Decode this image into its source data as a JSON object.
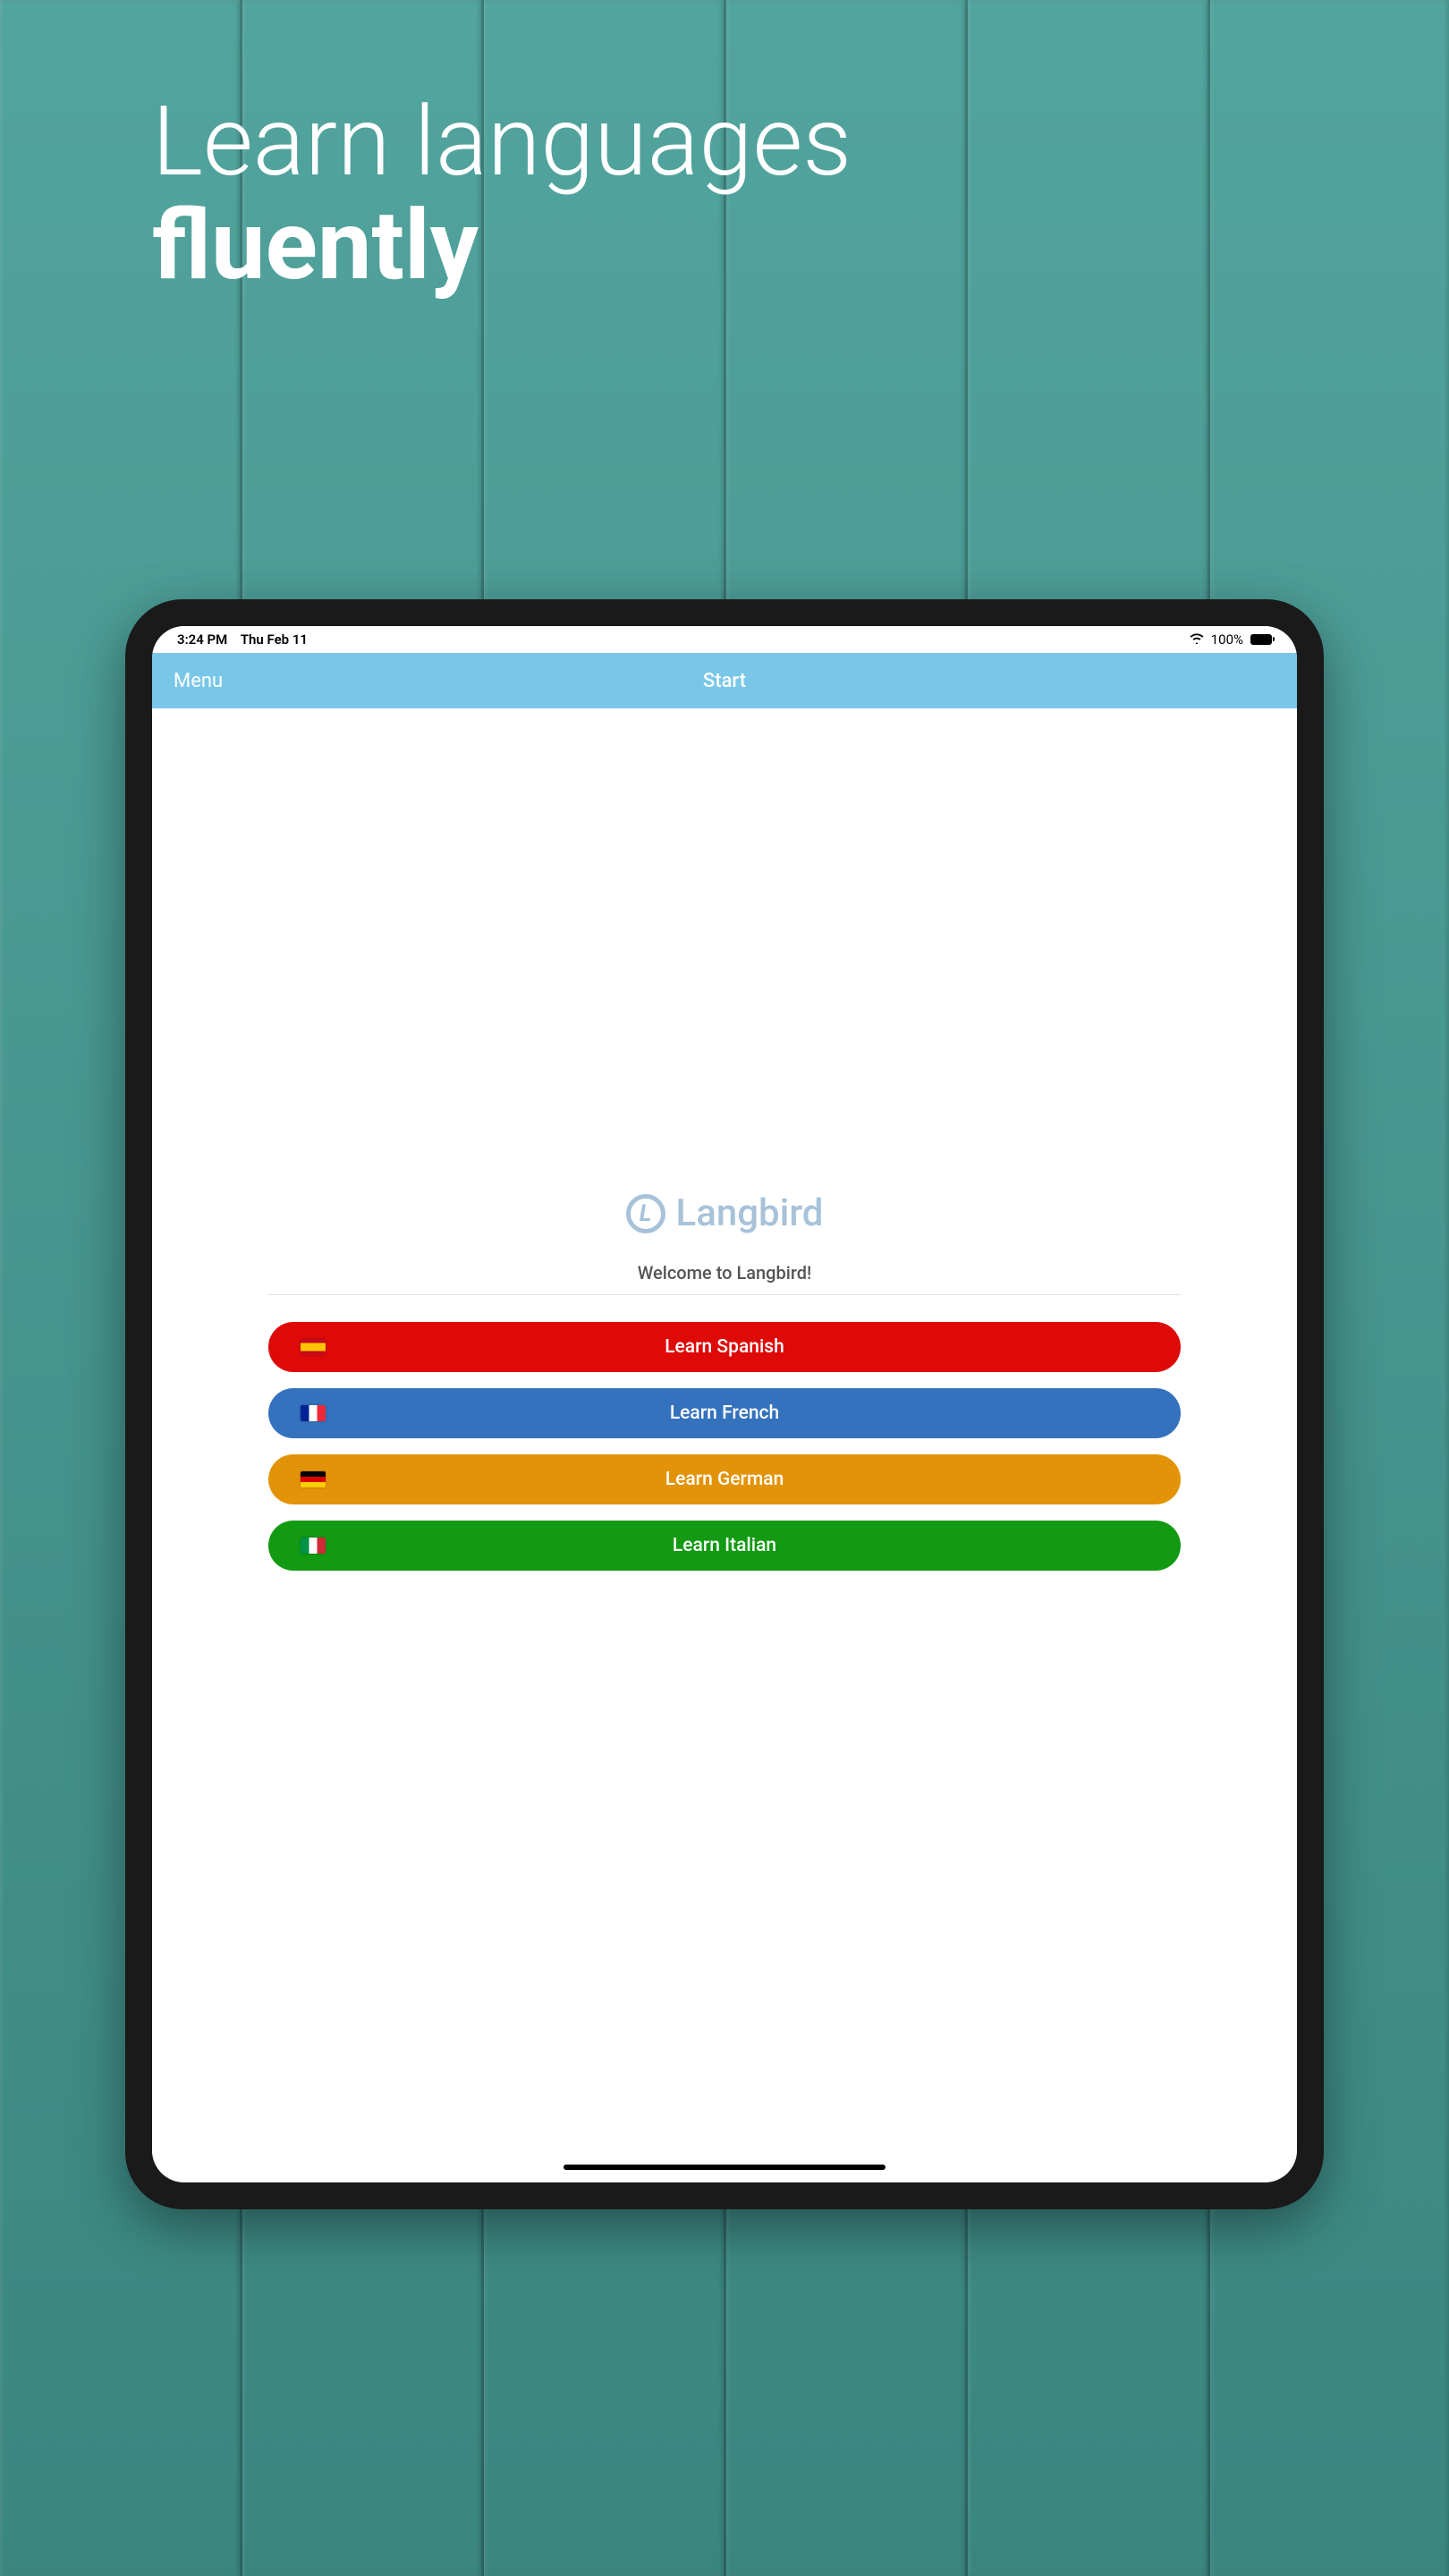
{
  "hero": {
    "line1": "Learn languages",
    "line2": "fluently"
  },
  "status_bar": {
    "time": "3:24 PM",
    "date": "Thu Feb 11",
    "battery_percent": "100%",
    "wifi_icon": "wifi"
  },
  "nav": {
    "menu_label": "Menu",
    "title": "Start"
  },
  "logo": {
    "letter": "L",
    "name": "Langbird"
  },
  "welcome": "Welcome to Langbird!",
  "languages": [
    {
      "label": "Learn Spanish",
      "flag": "spain",
      "color": "#de0a08"
    },
    {
      "label": "Learn French",
      "flag": "france",
      "color": "#3472be"
    },
    {
      "label": "Learn German",
      "flag": "germany",
      "color": "#e39307"
    },
    {
      "label": "Learn Italian",
      "flag": "italy",
      "color": "#129a12"
    }
  ]
}
